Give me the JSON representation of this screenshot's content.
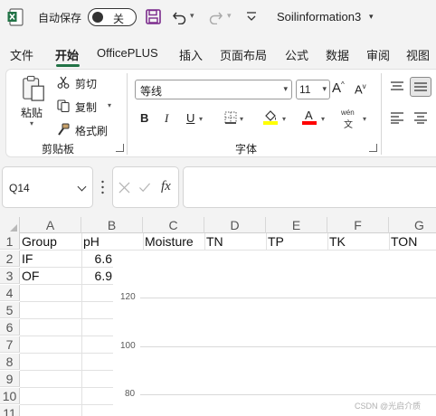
{
  "titlebar": {
    "autosave_label": "自动保存",
    "autosave_state": "关",
    "filename": "Soilinformation3"
  },
  "tabs": [
    {
      "label": "文件",
      "active": false
    },
    {
      "label": "开始",
      "active": true
    },
    {
      "label": "OfficePLUS",
      "active": false
    },
    {
      "label": "插入",
      "active": false
    },
    {
      "label": "页面布局",
      "active": false
    },
    {
      "label": "公式",
      "active": false
    },
    {
      "label": "数据",
      "active": false
    },
    {
      "label": "审阅",
      "active": false
    },
    {
      "label": "视图",
      "active": false
    }
  ],
  "ribbon": {
    "clipboard": {
      "paste": "粘贴",
      "cut": "剪切",
      "copy": "复制",
      "format_painter": "格式刷",
      "group_label": "剪贴板"
    },
    "font": {
      "font_name": "等线",
      "font_size": "11",
      "bold": "B",
      "italic": "I",
      "underline": "U",
      "phonetic_top": "wén",
      "phonetic_bottom": "文",
      "group_label": "字体",
      "fill_color": "#ffff00",
      "font_color": "#ff0000"
    }
  },
  "formula_bar": {
    "name_box": "Q14",
    "fx": "fx",
    "formula": ""
  },
  "grid": {
    "columns": [
      "A",
      "B",
      "C",
      "D",
      "E",
      "F",
      "G"
    ],
    "rows": [
      "1",
      "2",
      "3",
      "4",
      "5",
      "6",
      "7",
      "8",
      "9",
      "10",
      "11"
    ],
    "cells": {
      "A1": "Group",
      "B1": "pH",
      "C1": "Moisture",
      "D1": "TN",
      "E1": "TP",
      "F1": "TK",
      "G1": "TON",
      "A2": "IF",
      "B2": "6.6",
      "A3": "OF",
      "B3": "6.9"
    }
  },
  "chart": {
    "y_ticks": [
      "120",
      "100",
      "80"
    ]
  },
  "watermark": "CSDN @光启介质",
  "colors": {
    "excel_green": "#217346",
    "accent_purple": "#7b2a8c"
  }
}
